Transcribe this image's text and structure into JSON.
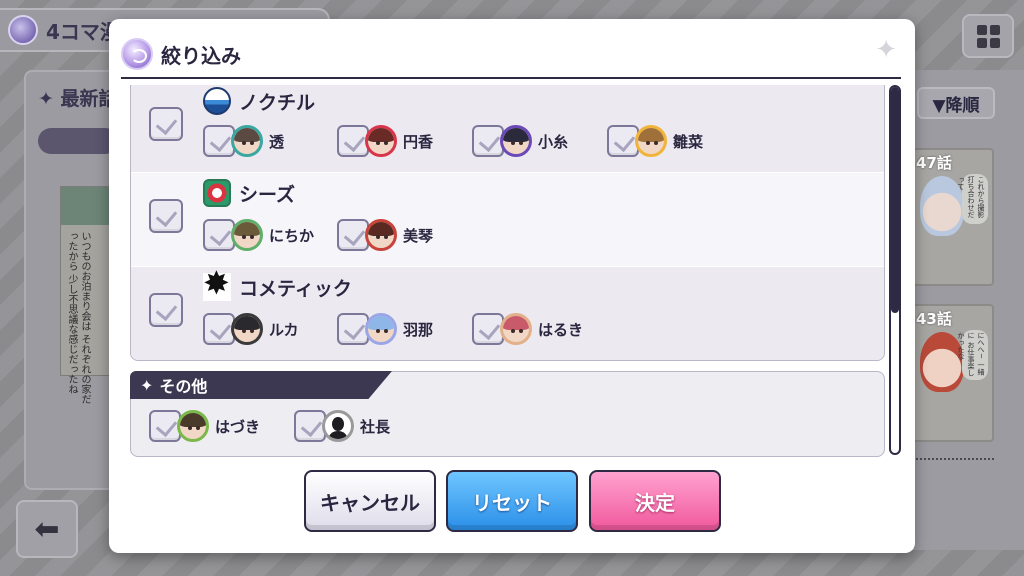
{
  "background": {
    "title": "4コマ漫",
    "latest_label": "最新話",
    "comic_text": "いつものお泊まり会は それぞれの家だったから 少し不思議な感じだったね",
    "sort_label": "▼降順",
    "cards": [
      {
        "episode": "47話",
        "speech": "これから撮影 打ち合わせだって"
      },
      {
        "episode": "43話",
        "speech": "にへへ~ 一緒に お仕事楽しかったな"
      }
    ],
    "back_icon": "arrow-left-icon",
    "grid_icon": "grid-icon"
  },
  "modal": {
    "title": "絞り込み",
    "units": [
      {
        "name": "ノクチル",
        "emblem": "noctchill-emblem-icon",
        "idols": [
          {
            "name": "透",
            "frame": "#3aa7a0",
            "hair": "#5b4a42"
          },
          {
            "name": "円香",
            "frame": "#d8344a",
            "hair": "#6a2a26"
          },
          {
            "name": "小糸",
            "frame": "#6b4ab8",
            "hair": "#2a2a3c"
          },
          {
            "name": "雛菜",
            "frame": "#f1b43a",
            "hair": "#a0703a"
          }
        ]
      },
      {
        "name": "シーズ",
        "emblem": "shhis-emblem-icon",
        "idols": [
          {
            "name": "にちか",
            "frame": "#5fae6a",
            "hair": "#6a5a3a"
          },
          {
            "name": "美琴",
            "frame": "#c8433a",
            "hair": "#5a2a22"
          }
        ]
      },
      {
        "name": "コメティック",
        "emblem": "cometik-emblem-icon",
        "idols": [
          {
            "name": "ルカ",
            "frame": "#3a3a3a",
            "hair": "#2a2a2e"
          },
          {
            "name": "羽那",
            "frame": "#9aa6e8",
            "hair": "#8fb6e8"
          },
          {
            "name": "はるき",
            "frame": "#e2b08a",
            "hair": "#c85a6a"
          }
        ]
      }
    ],
    "other": {
      "label": "その他",
      "idols": [
        {
          "name": "はづき",
          "frame": "#7ab84a",
          "hair": "#4a3a2a"
        },
        {
          "name": "社長",
          "frame": "#9a9a9a",
          "silhouette": true
        }
      ]
    },
    "buttons": {
      "cancel": "キャンセル",
      "reset": "リセット",
      "ok": "決定"
    },
    "scroll_position": 0.0
  }
}
